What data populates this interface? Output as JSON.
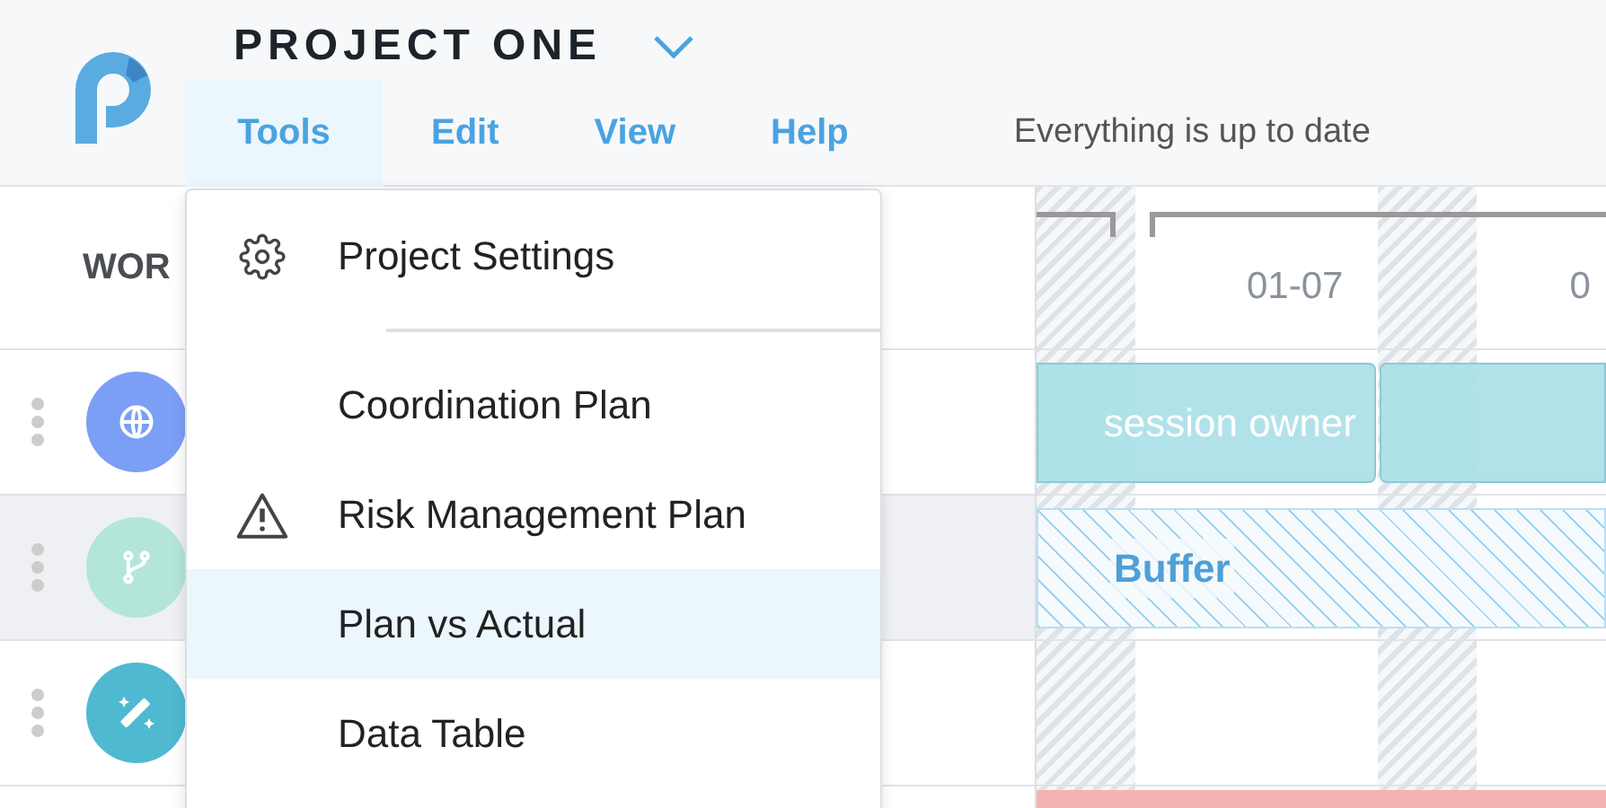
{
  "project": {
    "title": "PROJECT ONE"
  },
  "menu_bar": [
    {
      "label": "Tools",
      "selected": true
    },
    {
      "label": "Edit",
      "selected": false
    },
    {
      "label": "View",
      "selected": false
    },
    {
      "label": "Help",
      "selected": false
    }
  ],
  "status": "Everything is up to date",
  "table": {
    "column_1": "WOR",
    "rows": [
      {
        "kind": "globe",
        "color": "#7b9ff5",
        "selected": false
      },
      {
        "kind": "branch",
        "color": "#b3e6d9",
        "selected": true
      },
      {
        "kind": "wand",
        "color": "#4fb9d1",
        "selected": false
      }
    ]
  },
  "timeline": {
    "dates": [
      "01-07",
      "0"
    ],
    "rows": [
      {
        "kind": "task",
        "label": "session owner"
      },
      {
        "kind": "buffer",
        "label": "Buffer"
      },
      {
        "kind": "empty"
      }
    ]
  },
  "dropdown": [
    {
      "label": "Project Settings",
      "kind": "gear",
      "selected": false
    },
    {
      "label": "Coordination Plan",
      "kind": "plain",
      "selected": false
    },
    {
      "label": "Risk Management Plan",
      "kind": "warning",
      "selected": false
    },
    {
      "label": "Plan vs Actual",
      "kind": "plain",
      "selected": true
    },
    {
      "label": "Data Table",
      "kind": "plain",
      "selected": false
    }
  ]
}
